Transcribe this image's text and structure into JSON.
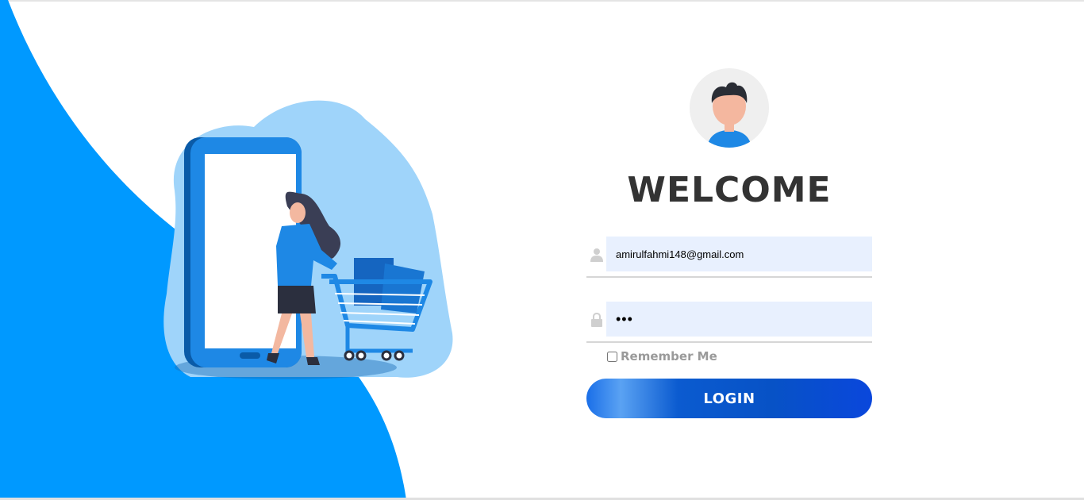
{
  "login": {
    "title": "WELCOME",
    "email_value": "amirulfahmi148@gmail.com",
    "password_value": "•••",
    "remember_label": "Remember Me",
    "button_label": "LOGIN"
  },
  "icons": {
    "avatar": "user-avatar-icon",
    "email": "user-icon",
    "password": "lock-icon"
  },
  "colors": {
    "brand_blue": "#0099ff",
    "button_start": "#1a6fe8",
    "button_end": "#0a47dc",
    "input_bg": "#e8f0fe",
    "title": "#333333"
  }
}
